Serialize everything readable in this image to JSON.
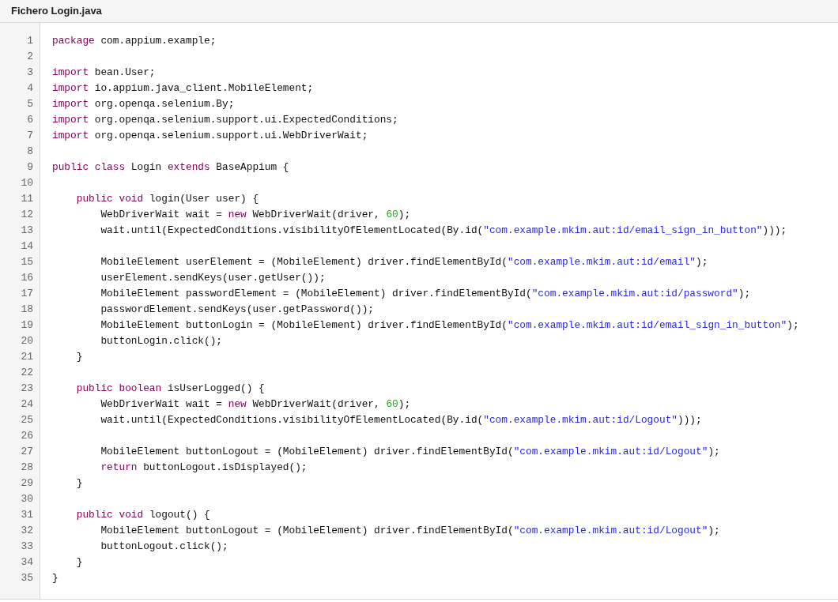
{
  "header": {
    "title": "Fichero Login.java"
  },
  "code": {
    "lines": [
      {
        "number": "1",
        "tokens": [
          {
            "kind": "keyword",
            "text": "package"
          },
          {
            "kind": "plain",
            "text": " com.appium.example;"
          }
        ]
      },
      {
        "number": "2"
      },
      {
        "number": "3",
        "tokens": [
          {
            "kind": "keyword",
            "text": "import"
          },
          {
            "kind": "plain",
            "text": " bean.User;"
          }
        ]
      },
      {
        "number": "4",
        "tokens": [
          {
            "kind": "keyword",
            "text": "import"
          },
          {
            "kind": "plain",
            "text": " io.appium.java_client.MobileElement;"
          }
        ]
      },
      {
        "number": "5",
        "tokens": [
          {
            "kind": "keyword",
            "text": "import"
          },
          {
            "kind": "plain",
            "text": " org.openqa.selenium.By;"
          }
        ]
      },
      {
        "number": "6",
        "tokens": [
          {
            "kind": "keyword",
            "text": "import"
          },
          {
            "kind": "plain",
            "text": " org.openqa.selenium.support.ui.ExpectedConditions;"
          }
        ]
      },
      {
        "number": "7",
        "tokens": [
          {
            "kind": "keyword",
            "text": "import"
          },
          {
            "kind": "plain",
            "text": " org.openqa.selenium.support.ui.WebDriverWait;"
          }
        ]
      },
      {
        "number": "8"
      },
      {
        "number": "9",
        "tokens": [
          {
            "kind": "keyword",
            "text": "public class"
          },
          {
            "kind": "plain",
            "text": " Login "
          },
          {
            "kind": "keyword",
            "text": "extends"
          },
          {
            "kind": "plain",
            "text": " BaseAppium {"
          }
        ]
      },
      {
        "number": "10"
      },
      {
        "number": "11",
        "tokens": [
          {
            "kind": "keyword",
            "text": "    public void"
          },
          {
            "kind": "plain",
            "text": " login(User user) {"
          }
        ]
      },
      {
        "number": "12",
        "tokens": [
          {
            "kind": "plain",
            "text": "        WebDriverWait wait = "
          },
          {
            "kind": "keyword",
            "text": "new"
          },
          {
            "kind": "plain",
            "text": " WebDriverWait(driver, "
          },
          {
            "kind": "number",
            "text": "60"
          },
          {
            "kind": "plain",
            "text": ");"
          }
        ]
      },
      {
        "number": "13",
        "tokens": [
          {
            "kind": "plain",
            "text": "        wait.until(ExpectedConditions.visibilityOfElementLocated(By.id("
          },
          {
            "kind": "string",
            "text": "\"com.example.mkim.aut:id/email_sign_in_button\""
          },
          {
            "kind": "plain",
            "text": ")));"
          }
        ]
      },
      {
        "number": "14"
      },
      {
        "number": "15",
        "tokens": [
          {
            "kind": "plain",
            "text": "        MobileElement userElement = (MobileElement) driver.findElementById("
          },
          {
            "kind": "string",
            "text": "\"com.example.mkim.aut:id/email\""
          },
          {
            "kind": "plain",
            "text": ");"
          }
        ]
      },
      {
        "number": "16",
        "tokens": [
          {
            "kind": "plain",
            "text": "        userElement.sendKeys(user.getUser());"
          }
        ]
      },
      {
        "number": "17",
        "tokens": [
          {
            "kind": "plain",
            "text": "        MobileElement passwordElement = (MobileElement) driver.findElementById("
          },
          {
            "kind": "string",
            "text": "\"com.example.mkim.aut:id/password\""
          },
          {
            "kind": "plain",
            "text": ");"
          }
        ]
      },
      {
        "number": "18",
        "tokens": [
          {
            "kind": "plain",
            "text": "        passwordElement.sendKeys(user.getPassword());"
          }
        ]
      },
      {
        "number": "19",
        "tokens": [
          {
            "kind": "plain",
            "text": "        MobileElement buttonLogin = (MobileElement) driver.findElementById("
          },
          {
            "kind": "string",
            "text": "\"com.example.mkim.aut:id/email_sign_in_button\""
          },
          {
            "kind": "plain",
            "text": ");"
          }
        ]
      },
      {
        "number": "20",
        "tokens": [
          {
            "kind": "plain",
            "text": "        buttonLogin.click();"
          }
        ]
      },
      {
        "number": "21",
        "tokens": [
          {
            "kind": "plain",
            "text": "    }"
          }
        ]
      },
      {
        "number": "22"
      },
      {
        "number": "23",
        "tokens": [
          {
            "kind": "keyword",
            "text": "    public boolean"
          },
          {
            "kind": "plain",
            "text": " isUserLogged() {"
          }
        ]
      },
      {
        "number": "24",
        "tokens": [
          {
            "kind": "plain",
            "text": "        WebDriverWait wait = "
          },
          {
            "kind": "keyword",
            "text": "new"
          },
          {
            "kind": "plain",
            "text": " WebDriverWait(driver, "
          },
          {
            "kind": "number",
            "text": "60"
          },
          {
            "kind": "plain",
            "text": ");"
          }
        ]
      },
      {
        "number": "25",
        "tokens": [
          {
            "kind": "plain",
            "text": "        wait.until(ExpectedConditions.visibilityOfElementLocated(By.id("
          },
          {
            "kind": "string",
            "text": "\"com.example.mkim.aut:id/Logout\""
          },
          {
            "kind": "plain",
            "text": ")));"
          }
        ]
      },
      {
        "number": "26"
      },
      {
        "number": "27",
        "tokens": [
          {
            "kind": "plain",
            "text": "        MobileElement buttonLogout = (MobileElement) driver.findElementById("
          },
          {
            "kind": "string",
            "text": "\"com.example.mkim.aut:id/Logout\""
          },
          {
            "kind": "plain",
            "text": ");"
          }
        ]
      },
      {
        "number": "28",
        "tokens": [
          {
            "kind": "keyword",
            "text": "        return"
          },
          {
            "kind": "plain",
            "text": " buttonLogout.isDisplayed();"
          }
        ]
      },
      {
        "number": "29",
        "tokens": [
          {
            "kind": "plain",
            "text": "    }"
          }
        ]
      },
      {
        "number": "30"
      },
      {
        "number": "31",
        "tokens": [
          {
            "kind": "keyword",
            "text": "    public void"
          },
          {
            "kind": "plain",
            "text": " logout() {"
          }
        ]
      },
      {
        "number": "32",
        "tokens": [
          {
            "kind": "plain",
            "text": "        MobileElement buttonLogout = (MobileElement) driver.findElementById("
          },
          {
            "kind": "string",
            "text": "\"com.example.mkim.aut:id/Logout\""
          },
          {
            "kind": "plain",
            "text": ");"
          }
        ]
      },
      {
        "number": "33",
        "tokens": [
          {
            "kind": "plain",
            "text": "        buttonLogout.click();"
          }
        ]
      },
      {
        "number": "34",
        "tokens": [
          {
            "kind": "plain",
            "text": "    }"
          }
        ]
      },
      {
        "number": "35",
        "tokens": [
          {
            "kind": "plain",
            "text": "}"
          }
        ]
      }
    ]
  }
}
